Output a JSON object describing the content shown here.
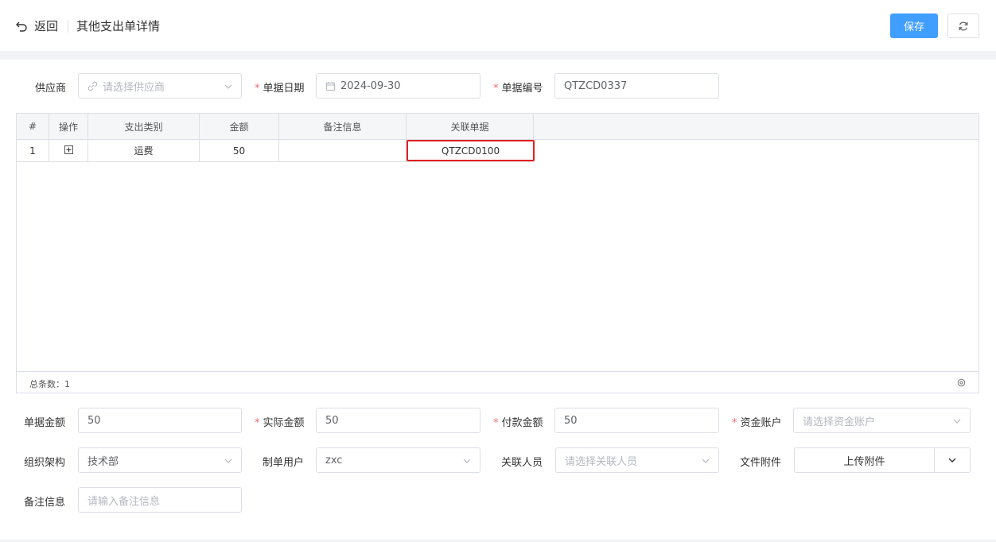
{
  "header": {
    "back_label": "返回",
    "title": "其他支出单详情",
    "save_label": "保存"
  },
  "form": {
    "supplier": {
      "label": "供应商",
      "placeholder": "请选择供应商"
    },
    "date": {
      "label": "单据日期",
      "value": "2024-09-30"
    },
    "number": {
      "label": "单据编号",
      "value": "QTZCD0337"
    }
  },
  "table": {
    "columns": [
      "#",
      "操作",
      "支出类别",
      "金额",
      "备注信息",
      "关联单据"
    ],
    "rows": [
      {
        "index": "1",
        "category": "运费",
        "amount": "50",
        "remark": "",
        "related": "QTZCD0100"
      }
    ],
    "total_label": "总条数：1"
  },
  "summary": {
    "doc_amount": {
      "label": "单据金额",
      "value": "50"
    },
    "actual_amount": {
      "label": "实际金额",
      "value": "50"
    },
    "pay_amount": {
      "label": "付款金额",
      "value": "50"
    },
    "account": {
      "label": "资金账户",
      "placeholder": "请选择资金账户"
    },
    "org": {
      "label": "组织架构",
      "value": "技术部"
    },
    "creator": {
      "label": "制单用户",
      "value": "zxc"
    },
    "related_person": {
      "label": "关联人员",
      "placeholder": "请选择关联人员"
    },
    "attachment": {
      "label": "文件附件",
      "button": "上传附件"
    },
    "remark": {
      "label": "备注信息",
      "placeholder": "请输入备注信息"
    }
  },
  "colors": {
    "primary": "#409eff",
    "required": "#f56c6c",
    "highlight": "#e02020"
  }
}
